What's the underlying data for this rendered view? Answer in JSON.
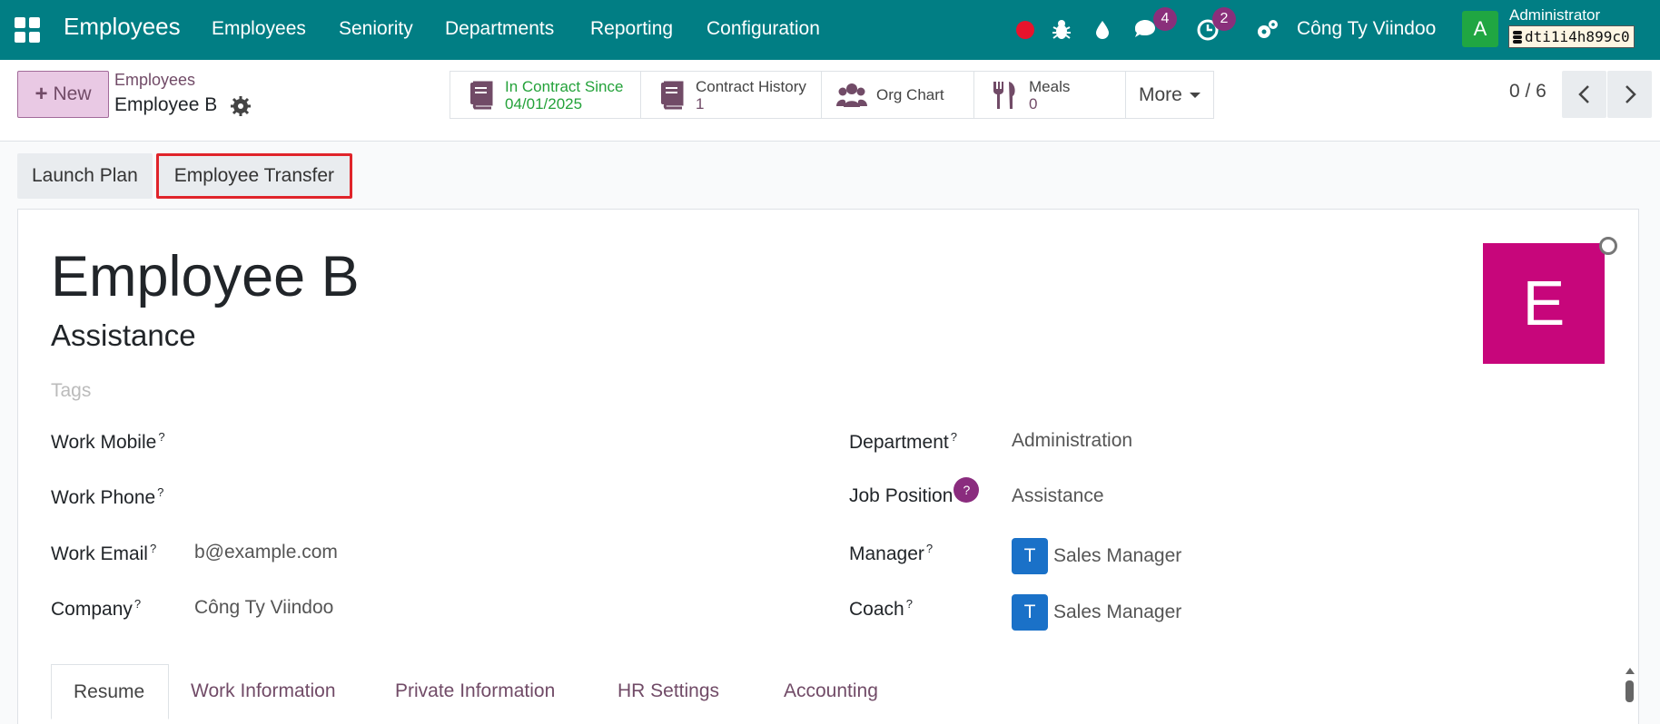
{
  "navbar": {
    "app_title": "Employees",
    "menu": [
      "Employees",
      "Seniority",
      "Departments",
      "Reporting",
      "Configuration"
    ],
    "messages_count": "4",
    "activities_count": "2",
    "company": "Công Ty Viindoo",
    "avatar_letter": "A",
    "user": "Administrator",
    "db": "dti1i4h899c0"
  },
  "control": {
    "new_label": "New",
    "breadcrumb_parent": "Employees",
    "breadcrumb_current": "Employee B",
    "smart_buttons": [
      {
        "label": "In Contract Since",
        "value": "04/01/2025",
        "icon": "book-icon"
      },
      {
        "label": "Contract History",
        "value": "1",
        "icon": "book-icon"
      },
      {
        "label": "Org Chart",
        "value": "",
        "icon": "users-icon"
      },
      {
        "label": "Meals",
        "value": "0",
        "icon": "utensils-icon"
      }
    ],
    "more_label": "More",
    "pager": "0 / 6"
  },
  "statusbar": {
    "launch_plan": "Launch Plan",
    "employee_transfer": "Employee Transfer"
  },
  "form": {
    "name": "Employee B",
    "job_title": "Assistance",
    "tags_placeholder": "Tags",
    "photo_letter": "E",
    "left_fields": [
      {
        "label": "Work Mobile",
        "value": ""
      },
      {
        "label": "Work Phone",
        "value": ""
      },
      {
        "label": "Work Email",
        "value": "b@example.com"
      },
      {
        "label": "Company",
        "value": "Công Ty Viindoo"
      }
    ],
    "right_fields": [
      {
        "label": "Department",
        "value": "Administration"
      },
      {
        "label": "Job Position",
        "value": "Assistance"
      },
      {
        "label": "Manager",
        "value": "Sales Manager",
        "avatar": "T"
      },
      {
        "label": "Coach",
        "value": "Sales Manager",
        "avatar": "T"
      }
    ],
    "help_mark": "?"
  },
  "tabs": [
    "Resume",
    "Work Information",
    "Private Information",
    "HR Settings",
    "Accounting"
  ],
  "colors": {
    "navbar": "#017e84",
    "primary": "#714b67",
    "photo": "#c7067b",
    "highlight": "#e0242a"
  }
}
